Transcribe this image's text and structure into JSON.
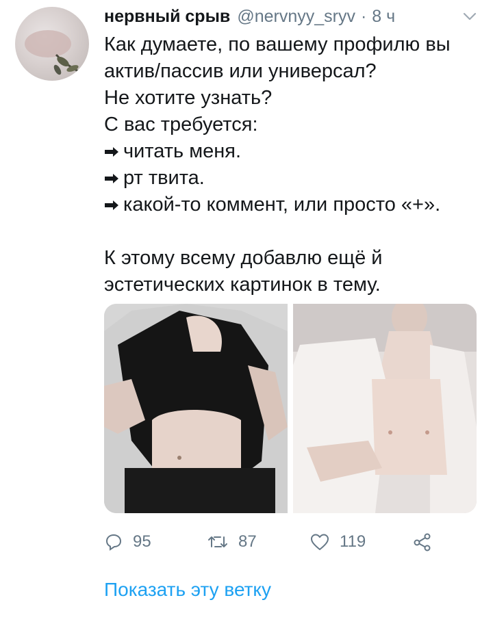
{
  "tweet": {
    "author_name": "нервный срыв",
    "author_handle": "@nervnyy_sryv",
    "separator": "·",
    "time": "8 ч",
    "lines": [
      "Как думаете, по вашему профилю вы",
      "актив/пассив или универсал?",
      "Не хотите узнать?",
      "С вас требуется:"
    ],
    "list_items": [
      "читать меня.",
      "рт твита.",
      "какой-то коммент, или просто «+»."
    ],
    "closing_lines": [
      "К этому всему добавлю ещё й",
      "эстетических картинок в тему."
    ]
  },
  "actions": {
    "reply_count": "95",
    "retweet_count": "87",
    "like_count": "119"
  },
  "thread_link": "Показать эту ветку",
  "colors": {
    "link": "#1da1f2",
    "muted": "#657786",
    "text": "#14171a"
  }
}
